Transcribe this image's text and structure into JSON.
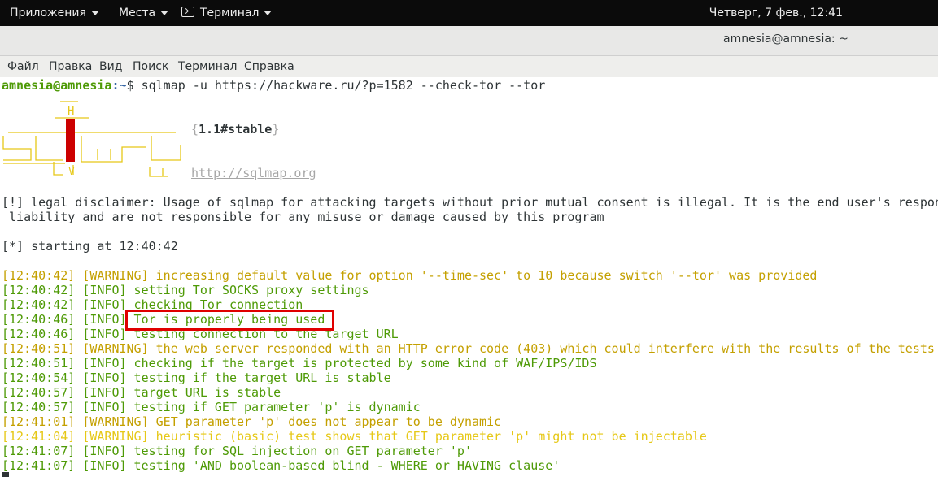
{
  "topbar": {
    "apps_label": "Приложения",
    "places_label": "Места",
    "terminal_label": "Терминал",
    "clock": "Четверг,  7 фев., 12:41"
  },
  "window": {
    "title": "amnesia@amnesia: ~"
  },
  "menubar": {
    "items": [
      "Файл",
      "Правка",
      "Вид",
      "Поиск",
      "Терминал",
      "Справка"
    ]
  },
  "prompt": {
    "user_host": "amnesia@amnesia",
    "path": ":~",
    "symbol": "$ ",
    "command": "sqlmap -u https://hackware.ru/?p=1582 --check-tor --tor"
  },
  "banner": {
    "art_h": "H",
    "version": "1.1#stable",
    "url": "http://sqlmap.org",
    "brace_open": "{",
    "brace_close": "}"
  },
  "disclaimer": [
    "[!] legal disclaimer: Usage of sqlmap for attacking targets without prior mutual consent is illegal. It is the end user's respon",
    " liability and are not responsible for any misuse or damage caused by this program"
  ],
  "starting": "[*] starting at 12:40:42",
  "log": [
    {
      "text": "[12:40:42] [WARNING] increasing default value for option '--time-sec' to 10 because switch '--tor' was provided",
      "level": "warning"
    },
    {
      "text": "[12:40:42] [INFO] setting Tor SOCKS proxy settings",
      "level": "info"
    },
    {
      "text": "[12:40:42] [INFO] checking Tor connection",
      "level": "info"
    },
    {
      "text": "[12:40:46] [INFO] Tor is properly being used",
      "level": "info"
    },
    {
      "text": "[12:40:46] [INFO] testing connection to the target URL",
      "level": "info"
    },
    {
      "text": "[12:40:51] [WARNING] the web server responded with an HTTP error code (403) which could interfere with the results of the tests",
      "level": "warning"
    },
    {
      "text": "[12:40:51] [INFO] checking if the target is protected by some kind of WAF/IPS/IDS",
      "level": "info"
    },
    {
      "text": "[12:40:54] [INFO] testing if the target URL is stable",
      "level": "info"
    },
    {
      "text": "[12:40:57] [INFO] target URL is stable",
      "level": "info"
    },
    {
      "text": "[12:40:57] [INFO] testing if GET parameter 'p' is dynamic",
      "level": "info"
    },
    {
      "text": "[12:41:01] [WARNING] GET parameter 'p' does not appear to be dynamic",
      "level": "warning"
    },
    {
      "text": "[12:41:04] [WARNING] heuristic (basic) test shows that GET parameter 'p' might not be injectable",
      "level": "warning-bright"
    },
    {
      "text": "[12:41:07] [INFO] testing for SQL injection on GET parameter 'p'",
      "level": "info"
    },
    {
      "text": "[12:41:07] [INFO] testing 'AND boolean-based blind - WHERE or HAVING clause'",
      "level": "info"
    }
  ],
  "highlight": {
    "color": "#e00000"
  },
  "colors": {
    "info": "#4e9a06",
    "warning": "#c4a000",
    "warning_bright": "#e6c817",
    "path": "#3465a4"
  }
}
